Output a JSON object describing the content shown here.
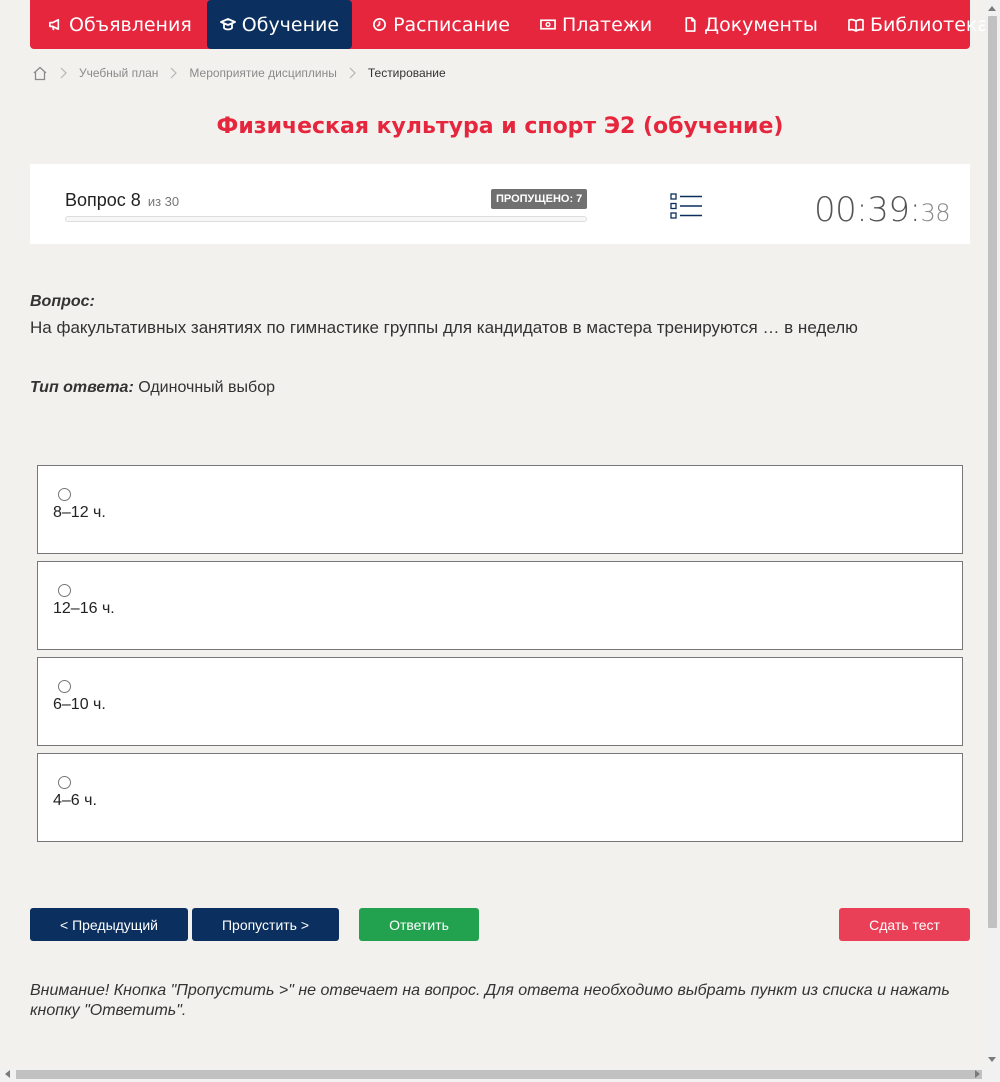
{
  "nav": {
    "items": [
      {
        "label": "Объявления",
        "icon": "megaphone-icon"
      },
      {
        "label": "Обучение",
        "icon": "graduation-cap-icon",
        "active": true
      },
      {
        "label": "Расписание",
        "icon": "clock-icon"
      },
      {
        "label": "Платежи",
        "icon": "money-icon"
      },
      {
        "label": "Документы",
        "icon": "document-icon"
      },
      {
        "label": "Библиотека",
        "icon": "book-icon",
        "dropdown": true
      }
    ]
  },
  "breadcrumb": {
    "home_icon": "home-icon",
    "items": [
      "Учебный план",
      "Мероприятие дисциплины",
      "Тестирование"
    ]
  },
  "page_title": "Физическая культура и спорт Э2 (обучение)",
  "question_header": {
    "label": "Вопрос 8",
    "of_label": "из 30",
    "skipped_badge": "ПРОПУЩЕНО: 7",
    "progress": 0,
    "timer_main": "00:39:",
    "timer_seconds": "38"
  },
  "question": {
    "label": "Вопрос:",
    "text": "На факультативных занятиях по гимнастике группы для кандидатов в мастера тренируются … в неделю",
    "type_label": "Тип ответа:",
    "type_value": "Одиночный выбор"
  },
  "options": [
    "8–12 ч.",
    "12–16 ч.",
    "6–10 ч.",
    "4–6 ч."
  ],
  "buttons": {
    "prev": "< Предыдущий",
    "skip": "Пропустить >",
    "answer": "Ответить",
    "submit": "Сдать тест"
  },
  "warning": "Внимание! Кнопка \"Пропустить >\" не отвечает на вопрос. Для ответа необходимо выбрать пункт из списка и нажать кнопку \"Ответить\".",
  "colors": {
    "brand_red": "#e5263d",
    "navy": "#0b2f5e",
    "green": "#22a24f",
    "submit_red": "#e94058",
    "background": "#f2f1ee"
  }
}
